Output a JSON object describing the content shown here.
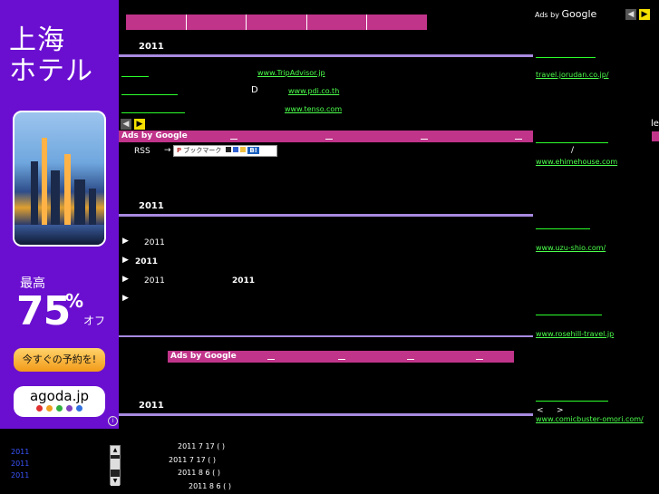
{
  "ad_banner": {
    "city_line1": "上海",
    "city_line2": "ホテル",
    "sale_prefix": "最高",
    "sale_number": "75",
    "sale_percent": "%",
    "sale_suffix": "オフ",
    "cta": "今すぐの予約を!",
    "brand": "agoda.jp",
    "info_glyph": "i",
    "dot_colors": [
      "#e03030",
      "#f0a020",
      "#30b040",
      "#8040c0",
      "#3070e0"
    ]
  },
  "main": {
    "year_heading_1": "2011",
    "links_row1": {
      "trip": "www.TripAdvisor.jp"
    },
    "links_row2": {
      "letter": "D",
      "pdi": "www.pdi.co.th"
    },
    "links_row3": {
      "tenso": "www.tenso.com"
    },
    "ads_label_1": "Ads by Google",
    "rss_label": "RSS",
    "rss_arrow": "→",
    "bookmark_label": "ブックマーク",
    "bookmark_badge": "B!",
    "year_heading_2": "2011",
    "bullets": [
      {
        "year": "2011",
        "extra": ""
      },
      {
        "year": "2011",
        "extra": ""
      },
      {
        "year": "2011",
        "extra": "2011"
      },
      {
        "year": "",
        "extra": ""
      }
    ],
    "ads_label_2": "Ads by Google",
    "year_heading_3": "2011"
  },
  "right_column": {
    "ads_prefix": "Ads by",
    "ads_brand": "Google",
    "links": [
      "travel.jorudan.co.jp/",
      "www.ehimehouse.com",
      "www.uzu-shio.com/",
      "www.rosehill-travel.jp",
      "www.comicbuster-omori.com/"
    ],
    "slash": "/",
    "nav_left": "<",
    "nav_right": ">",
    "edge_text": "le"
  },
  "archive": {
    "years": [
      "2011",
      "2011",
      "2011"
    ],
    "dates": [
      "2011 7 17 ( )",
      "2011 7 17 ( )",
      "2011 8 6 ( )",
      "2011 8 6 ( )"
    ]
  },
  "colors": {
    "accent_pink": "#c0348a",
    "banner_purple": "#6a0fd0",
    "link_green": "#4cff4c",
    "rule_lavender": "#a88ae0"
  }
}
